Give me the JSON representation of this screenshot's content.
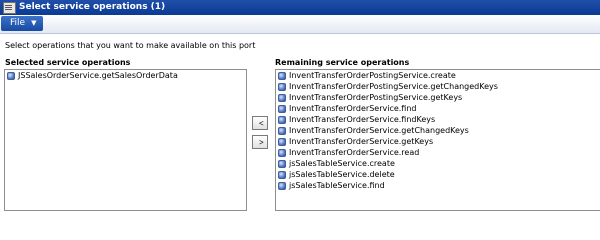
{
  "window": {
    "title": "Select service operations (1)"
  },
  "menu": {
    "file_label": "File",
    "caret": "▼"
  },
  "instructions": "Select operations that you want to make available on this port",
  "selected": {
    "heading": "Selected service operations",
    "items": [
      "JSSalesOrderService.getSalesOrderData"
    ]
  },
  "buttons": {
    "remove_label": "<",
    "add_label": ">"
  },
  "remaining": {
    "heading": "Remaining service operations",
    "items": [
      "InventTransferOrderPostingService.create",
      "InventTransferOrderPostingService.getChangedKeys",
      "InventTransferOrderPostingService.getKeys",
      "InventTransferOrderService.find",
      "InventTransferOrderService.findKeys",
      "InventTransferOrderService.getChangedKeys",
      "InventTransferOrderService.getKeys",
      "InventTransferOrderService.read",
      "jsSalesTableService.create",
      "jsSalesTableService.delete",
      "jsSalesTableService.find"
    ]
  }
}
